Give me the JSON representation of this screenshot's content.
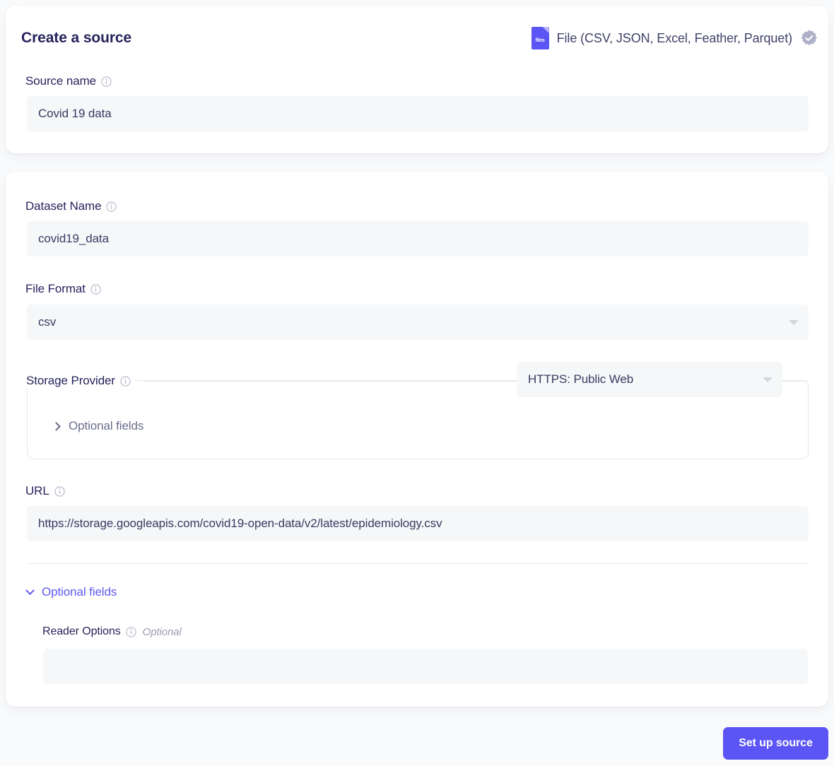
{
  "source_card": {
    "title": "Create a source",
    "source_type": {
      "icon": "file-icon",
      "icon_text": "files",
      "label": "File (CSV, JSON, Excel, Feather, Parquet)",
      "badge_icon": "verified-badge-icon"
    },
    "source_name": {
      "label": "Source name",
      "info_icon": "info-icon",
      "value": "Covid 19 data"
    }
  },
  "dataset_card": {
    "dataset_name": {
      "label": "Dataset Name",
      "info_icon": "info-icon",
      "value": "covid19_data"
    },
    "file_format": {
      "label": "File Format",
      "info_icon": "info-icon",
      "value": "csv",
      "caret_icon": "chevron-down-icon"
    },
    "storage_provider": {
      "label": "Storage Provider",
      "info_icon": "info-icon",
      "value": "HTTPS: Public Web",
      "caret_icon": "chevron-down-icon",
      "inner_optional_fields": {
        "label": "Optional fields",
        "chevron_icon": "chevron-right-icon"
      }
    },
    "url": {
      "label": "URL",
      "info_icon": "info-icon",
      "value": "https://storage.googleapis.com/covid19-open-data/v2/latest/epidemiology.csv"
    },
    "optional_fields_toggle": {
      "label": "Optional fields",
      "chevron_icon": "chevron-down-icon"
    },
    "reader_options": {
      "label": "Reader Options",
      "info_icon": "info-icon",
      "optional_tag": "Optional",
      "value": ""
    }
  },
  "footer": {
    "submit_label": "Set up source"
  },
  "colors": {
    "accent": "#5b55f5",
    "link": "#6158f0",
    "heading": "#26235c",
    "input_bg": "#f6f7f9",
    "page_bg": "#f9fafb"
  }
}
